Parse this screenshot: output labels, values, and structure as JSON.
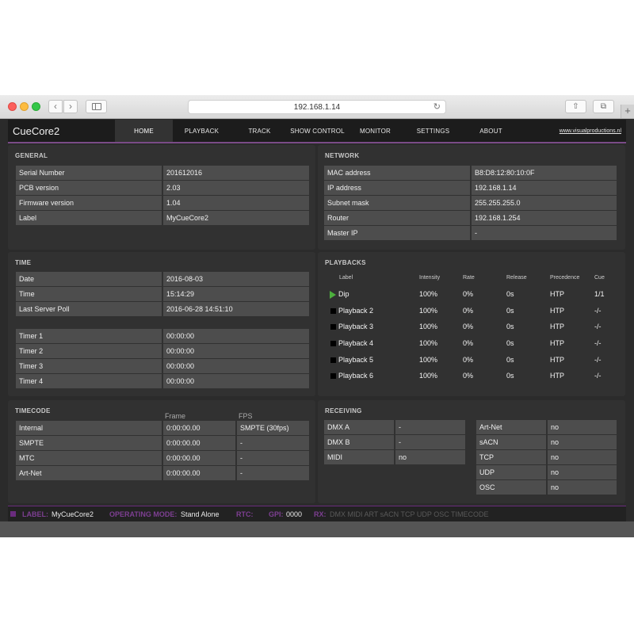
{
  "browser": {
    "url": "192.168.1.14",
    "back_icon": "chevron-left-icon",
    "forward_icon": "chevron-right-icon"
  },
  "app": {
    "brand": "CueCore2",
    "tabs": [
      "HOME",
      "PLAYBACK",
      "TRACK",
      "SHOW CONTROL",
      "MONITOR",
      "SETTINGS",
      "ABOUT"
    ],
    "active_tab": "HOME",
    "website": "www.visualproductions.nl",
    "accent": "#7a4b87"
  },
  "general": {
    "title": "GENERAL",
    "rows": [
      {
        "label": "Serial Number",
        "value": "201612016"
      },
      {
        "label": "PCB version",
        "value": "2.03"
      },
      {
        "label": "Firmware version",
        "value": "1.04"
      },
      {
        "label": "Label",
        "value": "MyCueCore2"
      }
    ]
  },
  "network": {
    "title": "NETWORK",
    "rows": [
      {
        "label": "MAC address",
        "value": "B8:D8:12:80:10:0F"
      },
      {
        "label": "IP address",
        "value": "192.168.1.14"
      },
      {
        "label": "Subnet mask",
        "value": "255.255.255.0"
      },
      {
        "label": "Router",
        "value": "192.168.1.254"
      },
      {
        "label": "Master IP",
        "value": "-"
      }
    ]
  },
  "time": {
    "title": "TIME",
    "rows": [
      {
        "label": "Date",
        "value": "2016-08-03"
      },
      {
        "label": "Time",
        "value": "15:14:29"
      },
      {
        "label": "Last Server Poll",
        "value": "2016-06-28 14:51:10"
      }
    ],
    "timers": [
      {
        "label": "Timer 1",
        "value": "00:00:00"
      },
      {
        "label": "Timer 2",
        "value": "00:00:00"
      },
      {
        "label": "Timer 3",
        "value": "00:00:00"
      },
      {
        "label": "Timer 4",
        "value": "00:00:00"
      }
    ]
  },
  "playbacks": {
    "title": "PLAYBACKS",
    "headers": [
      "Label",
      "Intensity",
      "Rate",
      "Release",
      "Precedence",
      "Cue"
    ],
    "rows": [
      {
        "icon": "play-icon",
        "label": "Dip",
        "intensity": "100%",
        "rate": "0%",
        "release": "0s",
        "precedence": "HTP",
        "cue": "1/1"
      },
      {
        "icon": "stop-icon",
        "label": "Playback 2",
        "intensity": "100%",
        "rate": "0%",
        "release": "0s",
        "precedence": "HTP",
        "cue": "-/-"
      },
      {
        "icon": "stop-icon",
        "label": "Playback 3",
        "intensity": "100%",
        "rate": "0%",
        "release": "0s",
        "precedence": "HTP",
        "cue": "-/-"
      },
      {
        "icon": "stop-icon",
        "label": "Playback 4",
        "intensity": "100%",
        "rate": "0%",
        "release": "0s",
        "precedence": "HTP",
        "cue": "-/-"
      },
      {
        "icon": "stop-icon",
        "label": "Playback 5",
        "intensity": "100%",
        "rate": "0%",
        "release": "0s",
        "precedence": "HTP",
        "cue": "-/-"
      },
      {
        "icon": "stop-icon",
        "label": "Playback 6",
        "intensity": "100%",
        "rate": "0%",
        "release": "0s",
        "precedence": "HTP",
        "cue": "-/-"
      }
    ],
    "play_color": "#4caf3d"
  },
  "timecode": {
    "title": "TIMECODE",
    "headers": {
      "frame": "Frame",
      "fps": "FPS"
    },
    "rows": [
      {
        "label": "Internal",
        "frame": "0:00:00.00",
        "fps": "SMPTE (30fps)"
      },
      {
        "label": "SMPTE",
        "frame": "0:00:00.00",
        "fps": "-"
      },
      {
        "label": "MTC",
        "frame": "0:00:00.00",
        "fps": "-"
      },
      {
        "label": "Art-Net",
        "frame": "0:00:00.00",
        "fps": "-"
      }
    ]
  },
  "receiving": {
    "title": "RECEIVING",
    "left": [
      {
        "label": "DMX A",
        "value": "-"
      },
      {
        "label": "DMX B",
        "value": "-"
      },
      {
        "label": "MIDI",
        "value": "no"
      }
    ],
    "right": [
      {
        "label": "Art-Net",
        "value": "no"
      },
      {
        "label": "sACN",
        "value": "no"
      },
      {
        "label": "TCP",
        "value": "no"
      },
      {
        "label": "UDP",
        "value": "no"
      },
      {
        "label": "OSC",
        "value": "no"
      }
    ]
  },
  "statusbar": {
    "label_key": "LABEL:",
    "label_val": "MyCueCore2",
    "mode_key": "OPERATING MODE:",
    "mode_val": "Stand Alone",
    "rtc_key": "RTC:",
    "gpi_key": "GPI:",
    "gpi_val": "0000",
    "rx_key": "RX:",
    "rx_items": "DMX MIDI ART sACN TCP UDP OSC TIMECODE"
  }
}
